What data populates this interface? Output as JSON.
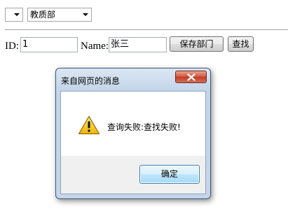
{
  "form": {
    "select1_value": "",
    "select2_value": "教质部",
    "id_label": "ID:",
    "id_value": "1",
    "name_label": "Name:",
    "name_value": "张三",
    "save_button": "保存部门",
    "search_button": "查找"
  },
  "dialog": {
    "title": "来自网页的消息",
    "message": "查询失败:查找失败!",
    "ok_button": "确定",
    "icon": "warning-icon"
  }
}
